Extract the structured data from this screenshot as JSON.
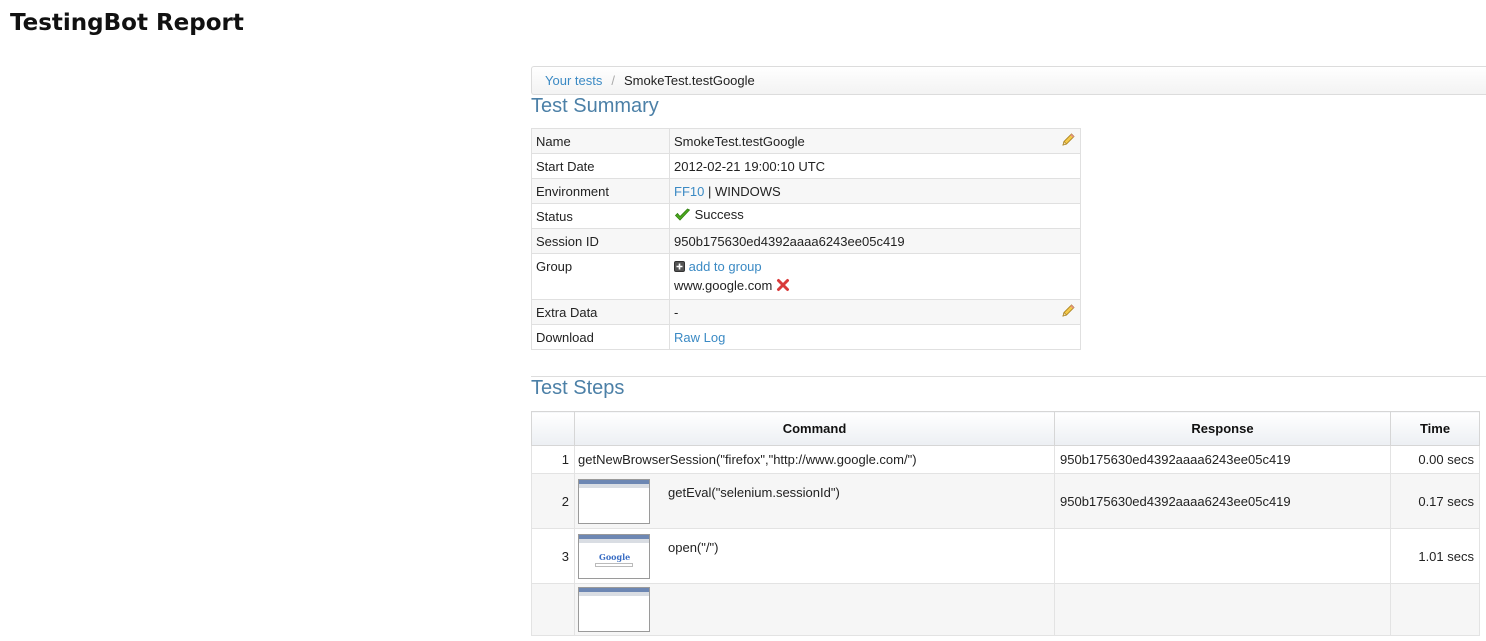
{
  "page_title": "TestingBot Report",
  "breadcrumb": {
    "root": "Your tests",
    "current": "SmokeTest.testGoogle"
  },
  "summary": {
    "heading": "Test Summary",
    "rows": {
      "name": {
        "label": "Name",
        "value": "SmokeTest.testGoogle"
      },
      "start_date": {
        "label": "Start Date",
        "value": "2012-02-21 19:00:10 UTC"
      },
      "environment": {
        "label": "Environment",
        "browser": "FF10",
        "os": " | WINDOWS"
      },
      "status": {
        "label": "Status",
        "value": "Success"
      },
      "session_id": {
        "label": "Session ID",
        "value": "950b175630ed4392aaaa6243ee05c419"
      },
      "group": {
        "label": "Group",
        "add_label": "add to group",
        "value": "www.google.com"
      },
      "extra_data": {
        "label": "Extra Data",
        "value": "-"
      },
      "download": {
        "label": "Download",
        "link": "Raw Log"
      }
    }
  },
  "steps": {
    "heading": "Test Steps",
    "columns": {
      "num": "",
      "command": "Command",
      "response": "Response",
      "time": "Time"
    },
    "rows": [
      {
        "num": "1",
        "command": "getNewBrowserSession(\"firefox\",\"http://www.google.com/\")",
        "response": "950b175630ed4392aaaa6243ee05c419",
        "time": "0.00 secs"
      },
      {
        "num": "2",
        "command": "getEval(\"selenium.sessionId\")",
        "response": "950b175630ed4392aaaa6243ee05c419",
        "time": "0.17 secs"
      },
      {
        "num": "3",
        "command": "open(\"/\")",
        "response": "",
        "time": "1.01 secs",
        "thumb_logo": "Google"
      }
    ]
  },
  "icons": {
    "edit": "pencil-icon",
    "status": "checkmark-icon",
    "add": "plus-square-icon",
    "remove": "red-x-icon"
  },
  "colors": {
    "link": "#3b8ac4",
    "heading": "#4c80a7",
    "success": "#4caa1f",
    "remove": "#d93a3a"
  }
}
